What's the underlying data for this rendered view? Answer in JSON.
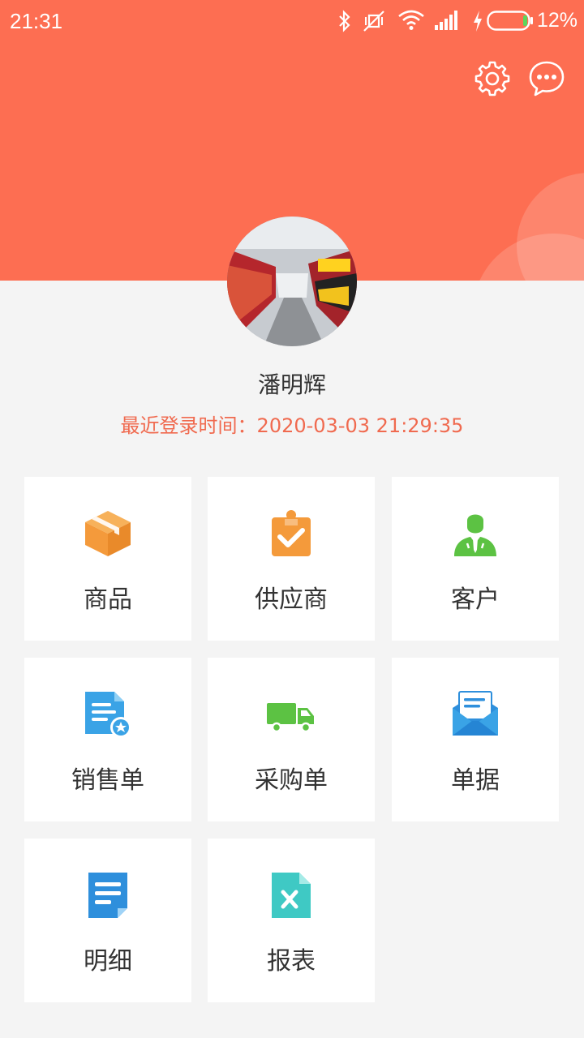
{
  "status_bar": {
    "time": "21:31",
    "battery": "12%"
  },
  "profile": {
    "name": "潘明辉",
    "last_login": "最近登录时间：2020-03-03 21:29:35"
  },
  "menu": [
    {
      "label": "商品",
      "icon": "box-icon",
      "color": "#f49a3b"
    },
    {
      "label": "供应商",
      "icon": "clipboard-check-icon",
      "color": "#f49a3b"
    },
    {
      "label": "客户",
      "icon": "person-icon",
      "color": "#5cc243"
    },
    {
      "label": "销售单",
      "icon": "document-star-icon",
      "color": "#3aa3e6"
    },
    {
      "label": "采购单",
      "icon": "truck-icon",
      "color": "#5cc243"
    },
    {
      "label": "单据",
      "icon": "envelope-icon",
      "color": "#2e8fdc"
    },
    {
      "label": "明细",
      "icon": "note-icon",
      "color": "#2e8fdc"
    },
    {
      "label": "报表",
      "icon": "excel-file-icon",
      "color": "#3fc9c4"
    }
  ]
}
